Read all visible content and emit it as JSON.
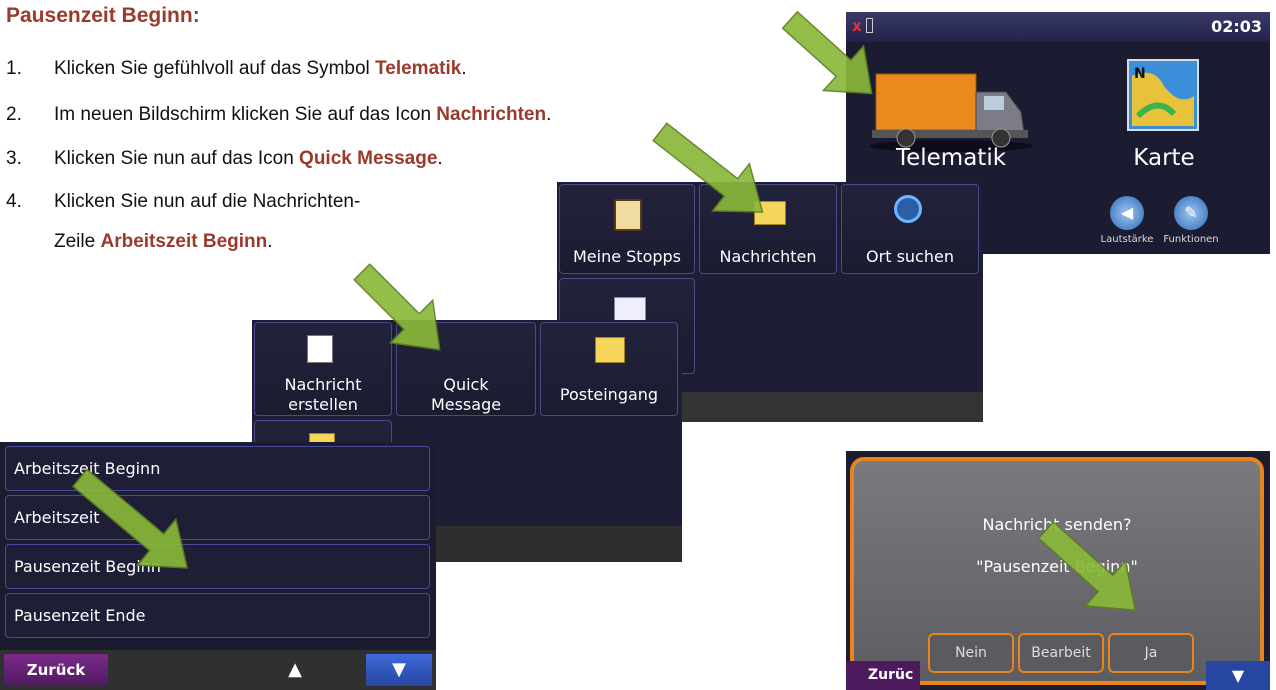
{
  "doc": {
    "heading": "Pausenzeit Beginn:",
    "steps": [
      {
        "num": "1.",
        "pre": "Klicken Sie gefühlvoll auf das Symbol ",
        "bold": "Telematik",
        "post": "."
      },
      {
        "num": "2.",
        "pre": "Im neuen Bildschirm klicken Sie auf das Icon ",
        "bold": "Nachrichten",
        "post": "."
      },
      {
        "num": "3.",
        "pre": "Klicken Sie nun auf das Icon ",
        "bold": "Quick Message",
        "post": "."
      },
      {
        "num": "4.",
        "pre1": "Klicken Sie nun auf die Nachrichten-",
        "pre2": "Zeile ",
        "bold": "Arbeitszeit Beginn",
        "post": "."
      }
    ]
  },
  "screen_main": {
    "time": "02:03",
    "telematik": "Telematik",
    "karte": "Karte",
    "lautstaerke": "Lautstärke",
    "funktionen": "Funktionen"
  },
  "screen_telematik": {
    "meine_stopps": "Meine Stopps",
    "nachrichten": "Nachrichten",
    "ort_suchen": "Ort suchen"
  },
  "screen_nachrichten": {
    "nachricht_erstellen_1": "Nachricht",
    "nachricht_erstellen_2": "erstellen",
    "quick_message_1": "Quick",
    "quick_message_2": "Message",
    "posteingang": "Posteingang"
  },
  "screen_list": {
    "items": [
      "Arbeitszeit Beginn",
      "Arbeitszeit",
      "Pausenzeit Beginn",
      "Pausenzeit Ende"
    ],
    "back": "Zurück"
  },
  "screen_dialog": {
    "question": "Nachricht senden?",
    "message": "\"Pausenzeit Beginn\"",
    "nein": "Nein",
    "bearbeit": "Bearbeit",
    "ja": "Ja",
    "back": "Zurüc"
  },
  "colors": {
    "accent_text": "#9b3a2c",
    "arrow": "#8ab83a",
    "dialog_border": "#e8841c"
  }
}
